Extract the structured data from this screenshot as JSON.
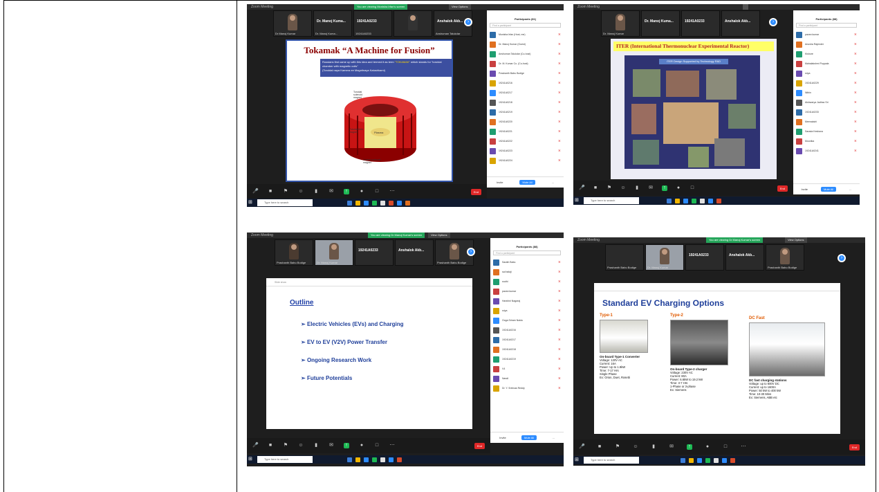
{
  "shots": [
    {
      "window_title": "Zoom Meeting",
      "banner": "You are viewing Monisha Irfan's screen",
      "view_options": "View Options",
      "thumbs": [
        {
          "name": "Dr Manoj Kumar",
          "big": ""
        },
        {
          "name": "Dr. Manoj Kuma...",
          "big": ""
        },
        {
          "name": "19241A0233",
          "big": "19241A0233"
        },
        {
          "name": "",
          "big": ""
        },
        {
          "name": "Anshuman Talukdar",
          "big": "Anshalok Akb..."
        }
      ],
      "slide": {
        "title": "Tokamak “A Machine for Fusion”",
        "box_line1": "Russians first came up with this idea and termed it as term",
        "box_highlight": "“TOKAMAK”",
        "box_line2": "which stands for “toroidal chamber with magnetic coils”",
        "box_line3": "(Toroidal naya Kamera ee Magnitnaya Katushkami)",
        "label_coils": "Toroidal solenoid magnet",
        "label_outer": "Poloidal field magnet",
        "label_inner": "Central solenoid magnet",
        "plasma": "Plasma"
      },
      "panel": {
        "title": "Participants (81)",
        "search": "Find a participant",
        "participants": [
          "Monisha Irfan (Host, me)",
          "Dr. Manoj Kumar (Guest)",
          "Anshuman Talukdar (Co-host)",
          "Dr. M. Kumar Co. (Co-host)",
          "Prashanth Babu Bodige",
          "19241A0216",
          "19241A0217",
          "19241A0218",
          "19241A0219",
          "19241A0220",
          "19241A0221",
          "19241A0222",
          "19241A0223",
          "19241A0224"
        ],
        "footer": [
          "Invite",
          "Mute All",
          "..."
        ]
      },
      "taskbar_search": "Type here to search",
      "end_label": "End"
    },
    {
      "window_title": "Zoom Meeting",
      "banner": "",
      "view_options": "",
      "thumbs": [
        {
          "name": "Dr. Manoj Kumar",
          "big": ""
        },
        {
          "name": "Dr. Manoj Kuma...",
          "big": "Dr. Manoj Kuma..."
        },
        {
          "name": "19241A0233",
          "big": "19241A0233"
        },
        {
          "name": "Anshuman Talukdar",
          "big": "Anshalok Akb..."
        }
      ],
      "slide": {
        "title": "ITER (International Thermonuclear Experimental Reactor)",
        "subtitle": "ITER Design Supported by Technology R&D"
      },
      "panel": {
        "title": "Participants (88)",
        "search": "Find a participant",
        "participants": [
          "pavan kumar",
          "Anusha Rajender",
          "Kishore",
          "Mahalakshmi Puppala",
          "sriya",
          "19241A0229",
          "Nithin",
          "Aishwarya Jadhav Sri",
          "19241A0233",
          "Meenakshi",
          "Sarada Keshava",
          "Mounika",
          "19241A0241"
        ],
        "footer": [
          "Invite",
          "Mute All",
          "..."
        ]
      },
      "taskbar_search": "Type here to search",
      "end_label": "End"
    },
    {
      "window_title": "Zoom Meeting",
      "banner": "You are viewing Dr Manoj Kumar's screen",
      "view_options": "View Options",
      "thumbs": [
        {
          "name": "Prashanth Babu Bodige",
          "big": ""
        },
        {
          "name": "Dr. Manoj Kumar",
          "big": ""
        },
        {
          "name": "19241A0233",
          "big": "19241A0233"
        },
        {
          "name": "Anshuman Talukdar",
          "big": "Anshalok Akb..."
        },
        {
          "name": "Prashanth Babu Bodige",
          "big": ""
        }
      ],
      "slide": {
        "topbar": "Slide show",
        "outline": "Outline",
        "items": [
          "Electric Vehicles (EVs) and Charging",
          "EV to EV (V2V) Power Transfer",
          "Ongoing Research Work",
          "Future Potentials"
        ]
      },
      "panel": {
        "title": "Participants (88)",
        "search": "Find a participant",
        "participants": [
          "Sarath Babu",
          "sai balaji",
          "sruthi",
          "pavan kumar",
          "Harshini Nagaraj",
          "sriya",
          "Ooga Sriram Naidu",
          "19241A0216",
          "19241A0217",
          "19241A0218",
          "19241A0219",
          "V4",
          "Nandi",
          "Dr. Y. Srinivas Reddy"
        ],
        "footer": [
          "Invite",
          "Mute All",
          "..."
        ]
      },
      "taskbar_search": "Type here to search",
      "end_label": "End"
    },
    {
      "window_title": "Zoom Meeting",
      "banner": "You are viewing Dr Manoj Kumar's screen",
      "view_options": "View Options",
      "thumbs": [
        {
          "name": "Prashanth Babu Bodige",
          "big": ""
        },
        {
          "name": "Dr. Manoj Kumar",
          "big": ""
        },
        {
          "name": "19241A0233",
          "big": "19241A0233"
        },
        {
          "name": "Anshuman Talukdar",
          "big": "Anshalok Akb..."
        },
        {
          "name": "Prashanth Babu Bodige",
          "big": ""
        }
      ],
      "slide": {
        "title": "Standard EV Charging Options",
        "cols": [
          {
            "head": "Type-1",
            "name": "On-board Type-1 Converter",
            "lines": [
              "Voltage: 120V AC",
              "Current: 16A",
              "Power: Up to 1.9kW",
              "Time: 7-17 Hrs",
              "Single Phase",
              "Ex: Orion, Duet, Rosetti"
            ]
          },
          {
            "head": "Type-2",
            "name": "On-board Type-2 charger",
            "lines": [
              "Voltage: 230V AC",
              "Current: 80A",
              "Power: 6.6kW to 19.2 kW",
              "Time: 3-7 Hrs",
              "1-Phase or 3-phase",
              "Ex: Siemens"
            ]
          },
          {
            "head": "DC Fast",
            "name": "DC fast charging stations",
            "lines": [
              "Voltage: up to 600V DC",
              "Current: up to 1600A",
              "Power: 50 kW to 400 kW",
              "Time: 10-30 Mins",
              "Ex: Siemens, ABB etc"
            ]
          }
        ]
      },
      "taskbar_search": "Type here to search",
      "end_label": "End"
    }
  ]
}
